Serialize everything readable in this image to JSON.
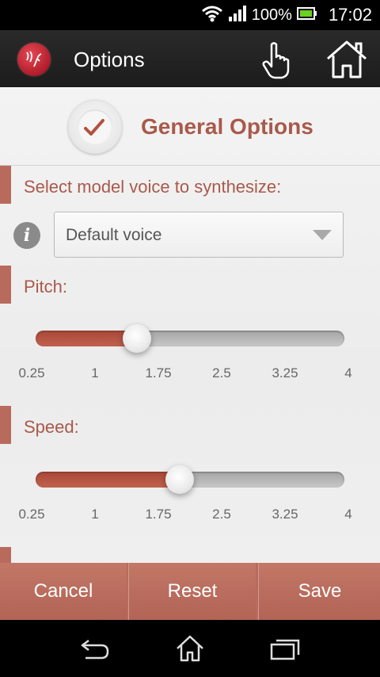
{
  "status_bar": {
    "battery_percent": "100%",
    "time": "17:02"
  },
  "action_bar": {
    "title": "Options"
  },
  "header": {
    "title": "General Options"
  },
  "voice": {
    "label": "Select model voice to synthesize:",
    "selected": "Default voice"
  },
  "pitch": {
    "label": "Pitch:",
    "value": 1.5,
    "min": 0.25,
    "max": 4,
    "ticks": [
      "0.25",
      "1",
      "1.75",
      "2.5",
      "3.25",
      "4"
    ]
  },
  "speed": {
    "label": "Speed:",
    "value": 2.0,
    "min": 0.25,
    "max": 4,
    "ticks": [
      "0.25",
      "1",
      "1.75",
      "2.5",
      "3.25",
      "4"
    ]
  },
  "buttons": {
    "cancel": "Cancel",
    "reset": "Reset",
    "save": "Save"
  },
  "colors": {
    "accent": "#a9594b",
    "button_bar": "#b86b5d",
    "slider_fill": "#b3503f"
  }
}
